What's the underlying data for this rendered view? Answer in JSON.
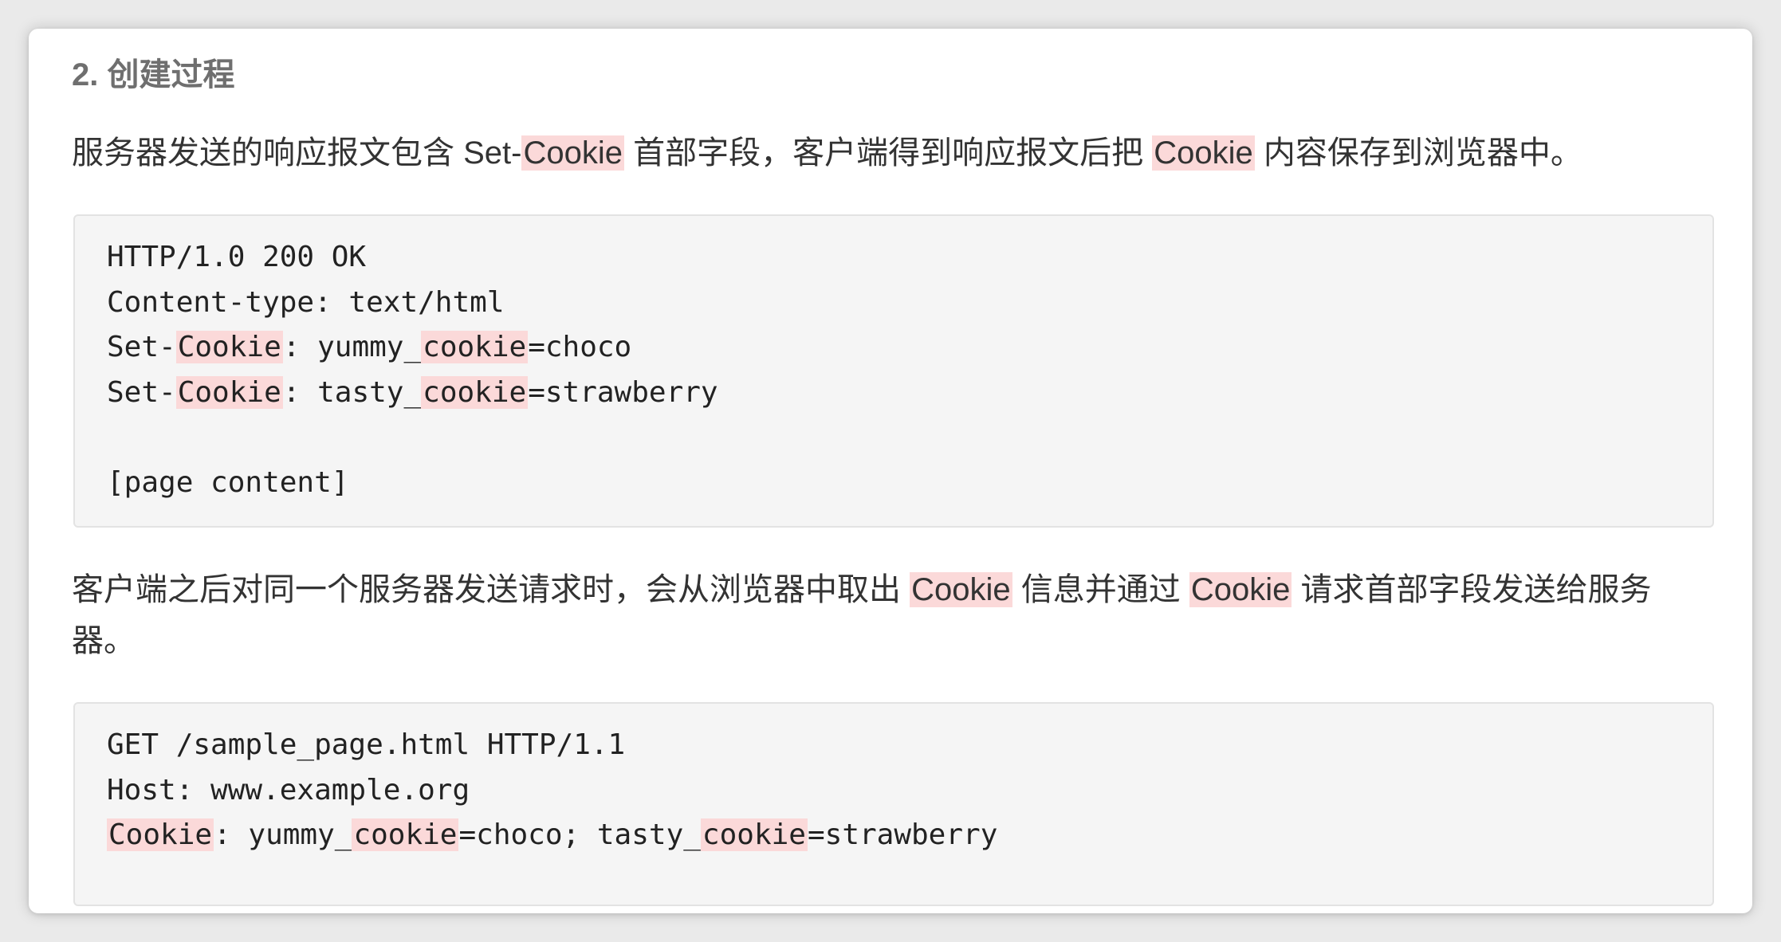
{
  "heading": "2. 创建过程",
  "paragraph1": {
    "seg1": "服务器发送的响应报文包含 Set-",
    "hl1": "Cookie",
    "seg2": " 首部字段，客户端得到响应报文后把 ",
    "hl2": "Cookie",
    "seg3": " 内容保存到浏览器中。"
  },
  "code1": {
    "line1": "HTTP/1.0 200 OK",
    "line2": "Content-type: text/html",
    "line3": {
      "a": "Set-",
      "b": "Cookie",
      "c": ": yummy_",
      "d": "cookie",
      "e": "=choco"
    },
    "line4": {
      "a": "Set-",
      "b": "Cookie",
      "c": ": tasty_",
      "d": "cookie",
      "e": "=strawberry"
    },
    "line6": "[page content]"
  },
  "paragraph2": {
    "seg1": "客户端之后对同一个服务器发送请求时，会从浏览器中取出 ",
    "hl1": "Cookie",
    "seg2": " 信息并通过 ",
    "hl2": "Cookie",
    "seg3": " 请求首部字段发送给服务器。"
  },
  "code2": {
    "line1": "GET /sample_page.html HTTP/1.1",
    "line2": "Host: www.example.org",
    "line3": {
      "a": "Cookie",
      "b": ": yummy_",
      "c": "cookie",
      "d": "=choco; tasty_",
      "e": "cookie",
      "f": "=strawberry"
    }
  },
  "colors": {
    "highlight": "#fbd9d9",
    "code_background": "#f5f5f5",
    "heading_text": "#6f6f6f",
    "body_text": "#333333"
  }
}
